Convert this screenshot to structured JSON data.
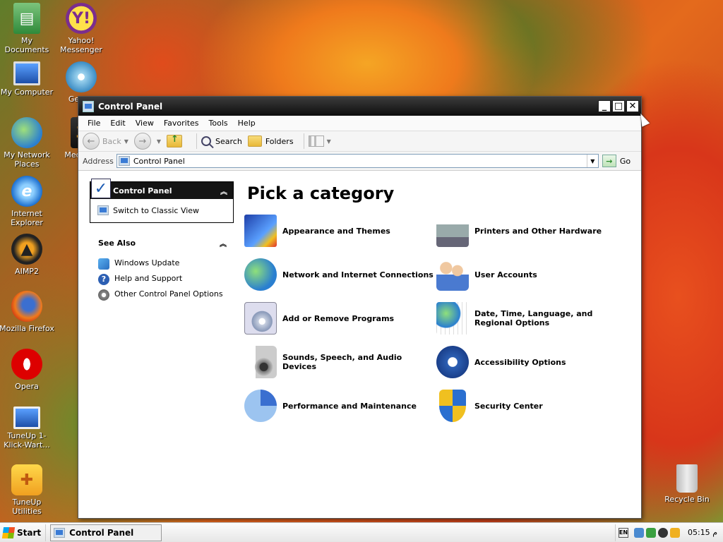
{
  "desktop": {
    "icons": [
      {
        "label": "My Documents"
      },
      {
        "label": "Yahoo! Messenger"
      },
      {
        "label": "My Computer"
      },
      {
        "label": "Ge Pro"
      },
      {
        "label": "My Network Places"
      },
      {
        "label": "Media Cl"
      },
      {
        "label": "Internet Explorer"
      },
      {
        "label": "AIMP2"
      },
      {
        "label": "Mozilla Firefox"
      },
      {
        "label": "Opera"
      },
      {
        "label": "TuneUp 1-Klick-Wart..."
      },
      {
        "label": "TuneUp Utilities"
      },
      {
        "label": "Recycle Bin"
      }
    ]
  },
  "window": {
    "title": "Control Panel",
    "minimize": "_",
    "maximize": "□",
    "close": "✕"
  },
  "menu": [
    "File",
    "Edit",
    "View",
    "Favorites",
    "Tools",
    "Help"
  ],
  "toolbar": {
    "back_label": "Back",
    "search_label": "Search",
    "folders_label": "Folders"
  },
  "address": {
    "label": "Address",
    "value": "Control Panel",
    "go_label": "Go"
  },
  "left_pane": {
    "panel_title": "Control Panel",
    "switch_label": "Switch to Classic View",
    "see_also_title": "See Also",
    "see_also_items": [
      {
        "label": "Windows Update",
        "color": "#3a9ad9"
      },
      {
        "label": "Help and Support",
        "color": "#2c5fb3"
      },
      {
        "label": "Other Control Panel Options",
        "color": "#888888"
      }
    ]
  },
  "main": {
    "title": "Pick a category",
    "categories": [
      {
        "label": "Appearance and Themes",
        "icon": "appearance-icon"
      },
      {
        "label": "Printers and Other Hardware",
        "icon": "printer-icon"
      },
      {
        "label": "Network and Internet Connections",
        "icon": "network-icon"
      },
      {
        "label": "User Accounts",
        "icon": "users-icon"
      },
      {
        "label": "Add or Remove Programs",
        "icon": "programs-icon"
      },
      {
        "label": "Date, Time, Language, and Regional Options",
        "icon": "datetime-icon"
      },
      {
        "label": "Sounds, Speech, and Audio Devices",
        "icon": "sound-icon"
      },
      {
        "label": "Accessibility Options",
        "icon": "accessibility-icon"
      },
      {
        "label": "Performance and Maintenance",
        "icon": "performance-icon"
      },
      {
        "label": "Security Center",
        "icon": "shield-icon"
      }
    ]
  },
  "taskbar": {
    "start_label": "Start",
    "task_label": "Control Panel",
    "lang": "EN",
    "clock": "05:15 م"
  }
}
